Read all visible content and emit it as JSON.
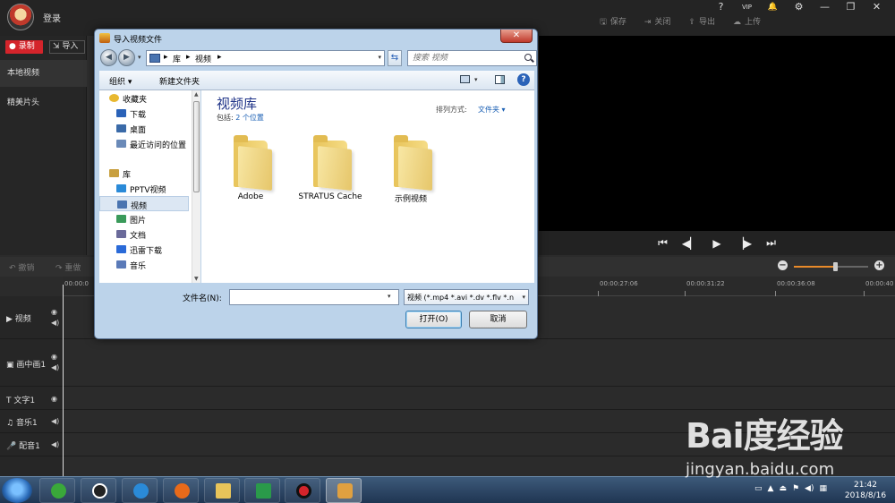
{
  "app": {
    "login_label": "登录",
    "window_controls": [
      "?",
      "VIP",
      "🔔",
      "⚙",
      "—",
      "❐",
      "✕"
    ],
    "actions": [
      {
        "icon": "save-icon",
        "glyph": "🖫",
        "label": "保存"
      },
      {
        "icon": "close-project-icon",
        "glyph": "⇥",
        "label": "关闭"
      },
      {
        "icon": "export-icon",
        "glyph": "⇪",
        "label": "导出"
      },
      {
        "icon": "upload-icon",
        "glyph": "☁",
        "label": "上传"
      }
    ],
    "record_label": "录制",
    "import_label": "导入",
    "nav": {
      "local_video": "本地视频",
      "clips": "精美片头"
    },
    "undo_label": "撤销",
    "redo_label": "重做",
    "zoom_level": 0.55,
    "ruler_ticks": [
      "00:00:0",
      "00:00:27:06",
      "00:00:31:22",
      "00:00:36:08",
      "00:00:40"
    ],
    "tracks": [
      {
        "label": "视频",
        "icon": "video-track-icon"
      },
      {
        "label": "画中画1",
        "icon": "pip-track-icon"
      },
      {
        "label": "文字1",
        "icon": "text-track-icon"
      },
      {
        "label": "音乐1",
        "icon": "music-track-icon"
      },
      {
        "label": "配音1",
        "icon": "voiceover-track-icon"
      }
    ],
    "accent_color": "#d4242b"
  },
  "dialog": {
    "title": "导入视频文件",
    "close_glyph": "✕",
    "breadcrumb": [
      "库",
      "视频"
    ],
    "search_placeholder": "搜索 视频",
    "organize_label": "组织 ▾",
    "new_folder_label": "新建文件夹",
    "nav_tree": [
      {
        "label": "收藏夹",
        "icon": "favorites-star-icon",
        "indent": 0
      },
      {
        "label": "下载",
        "icon": "downloads-icon",
        "indent": 1
      },
      {
        "label": "桌面",
        "icon": "desktop-icon",
        "indent": 1
      },
      {
        "label": "最近访问的位置",
        "icon": "recent-places-icon",
        "indent": 1
      },
      {
        "label": "库",
        "icon": "libraries-icon",
        "indent": 0
      },
      {
        "label": "PPTV视频",
        "icon": "pptv-library-icon",
        "indent": 1
      },
      {
        "label": "视频",
        "icon": "videos-library-icon",
        "indent": 1,
        "selected": true
      },
      {
        "label": "图片",
        "icon": "pictures-library-icon",
        "indent": 1
      },
      {
        "label": "文档",
        "icon": "documents-library-icon",
        "indent": 1
      },
      {
        "label": "迅雷下载",
        "icon": "xunlei-download-icon",
        "indent": 1
      },
      {
        "label": "音乐",
        "icon": "music-library-icon",
        "indent": 1
      }
    ],
    "library_title": "视频库",
    "includes_prefix": "包括: ",
    "includes_link": "2 个位置",
    "sort_label": "排列方式:",
    "sort_value": "文件夹 ▾",
    "folders": [
      "Adobe",
      "STRATUS Cache",
      "示例视频"
    ],
    "filename_label": "文件名(N):",
    "filename_value": "",
    "filetype_value": "视频 (*.mp4 *.avi *.dv *.flv *.n",
    "open_label": "打开(O)",
    "cancel_label": "取消"
  },
  "taskbar": {
    "apps": [
      "start-orb",
      "360-browser-icon",
      "qq-icon",
      "video-app-icon",
      "firefox-icon",
      "file-explorer-icon",
      "media-player-icon",
      "record-app-icon",
      "editor-app-icon"
    ],
    "time": "21:42",
    "date": "2018/8/16"
  },
  "watermark": {
    "logo": "Bai度经验",
    "url": "jingyan.baidu.com"
  }
}
